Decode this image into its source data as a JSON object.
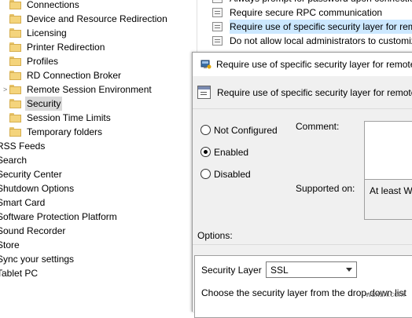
{
  "tree": {
    "items": [
      {
        "label": "Connections",
        "folder": true
      },
      {
        "label": "Device and Resource Redirection",
        "folder": true
      },
      {
        "label": "Licensing",
        "folder": true
      },
      {
        "label": "Printer Redirection",
        "folder": true
      },
      {
        "label": "Profiles",
        "folder": true
      },
      {
        "label": "RD Connection Broker",
        "folder": true
      },
      {
        "label": "Remote Session Environment",
        "folder": true,
        "expander": ">"
      },
      {
        "label": "Security",
        "folder": true,
        "selected": true
      },
      {
        "label": "Session Time Limits",
        "folder": true
      },
      {
        "label": "Temporary folders",
        "folder": true
      },
      {
        "label": "RSS Feeds",
        "folder": false
      },
      {
        "label": "Search",
        "folder": false
      },
      {
        "label": "Security Center",
        "folder": false
      },
      {
        "label": "Shutdown Options",
        "folder": false
      },
      {
        "label": "Smart Card",
        "folder": false
      },
      {
        "label": "Software Protection Platform",
        "folder": false
      },
      {
        "label": "Sound Recorder",
        "folder": false
      },
      {
        "label": "Store",
        "folder": false
      },
      {
        "label": "Sync your settings",
        "folder": false
      },
      {
        "label": "Tablet PC",
        "folder": false
      }
    ]
  },
  "policy_list": {
    "items": [
      {
        "label": "Always prompt for password upon connection"
      },
      {
        "label": "Require secure RPC communication"
      },
      {
        "label": "Require use of specific security layer for remote",
        "selected": true
      },
      {
        "label": "Do not allow local administrators to customize"
      }
    ]
  },
  "dialog": {
    "title": "Require use of specific security layer for remote",
    "header": "Require use of specific security layer for remote",
    "radios": [
      {
        "label": "Not Configured",
        "checked": false
      },
      {
        "label": "Enabled",
        "checked": true
      },
      {
        "label": "Disabled",
        "checked": false
      }
    ],
    "comment_label": "Comment:",
    "supported_label": "Supported on:",
    "supported_value": "At least Wi",
    "options_label": "Options:",
    "security_layer_label": "Security Layer",
    "security_layer_value": "SSL",
    "security_layer_help": "Choose the security layer from the drop-down list"
  },
  "watermark": "wsxdn.com"
}
